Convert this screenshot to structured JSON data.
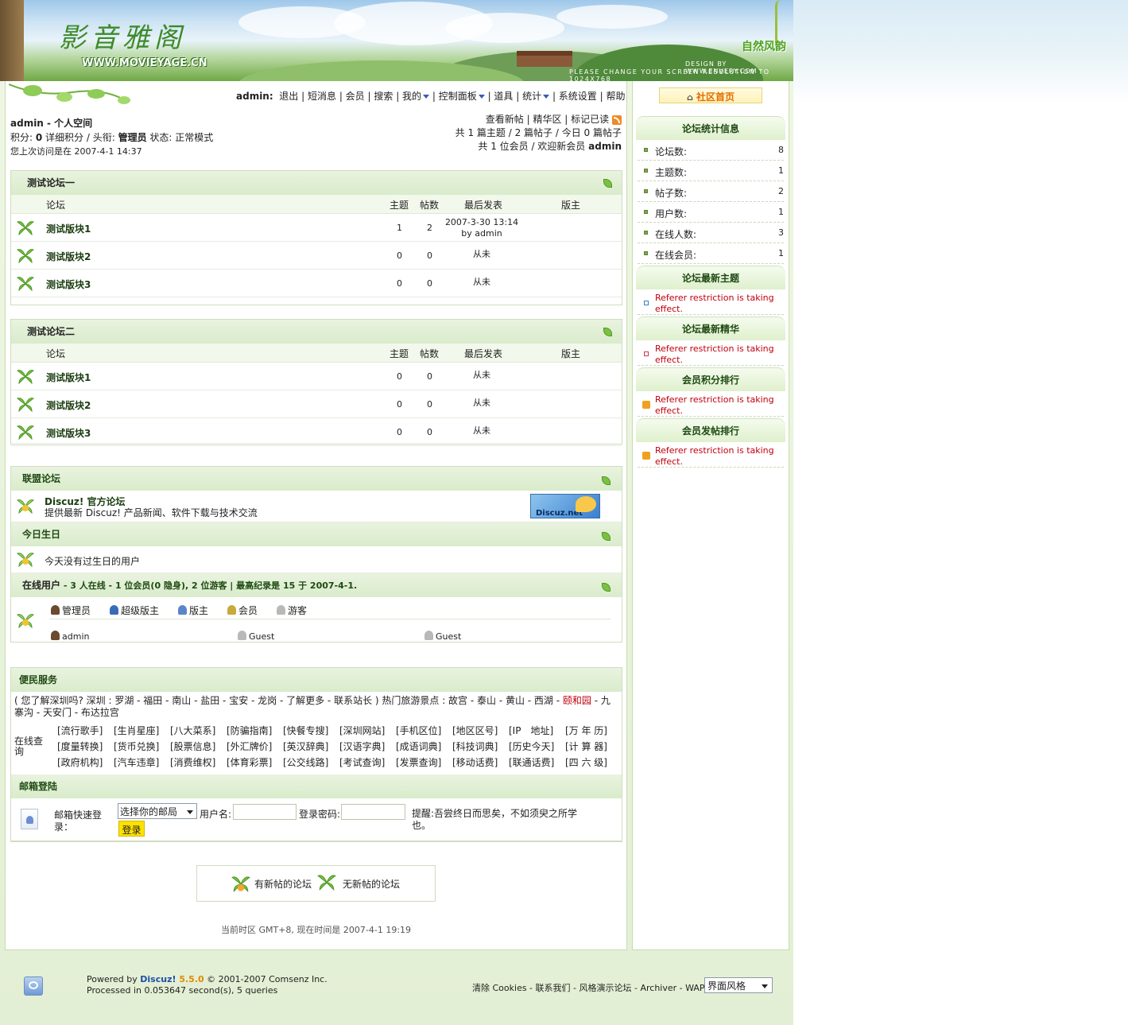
{
  "header": {
    "logo_title": "影音雅阁",
    "logo_url": "WWW.MOVIEYAGE.CN",
    "theme_name": "自然风韵",
    "design_by": "DESIGN BY WWW.ENVERY.COM",
    "resolution_note": "PLEASE CHANGE YOUR SCREEN RESOLUTION TO 1024X768"
  },
  "nav": {
    "user": "admin:",
    "items": [
      "退出",
      "短消息",
      "会员",
      "搜索",
      "我的",
      "控制面板",
      "道具",
      "统计",
      "系统设置",
      "帮助"
    ]
  },
  "user_info": {
    "space": "admin - 个人空间",
    "credits_line_1": "积分: ",
    "credits_value": "0",
    "credits_line_2": " 详细积分 / 头衔: ",
    "title_value": "管理员",
    "status": " 状态: 正常模式",
    "last_visit": "您上次访问是在 2007-4-1 14:37"
  },
  "posts_info": {
    "links": [
      "查看新帖",
      "精华区",
      "标记已读"
    ],
    "topics_line": "共 1 篇主题 / 2 篇帖子 / 今日 0 篇帖子",
    "members_line": "共 1 位会员 / 欢迎新会员 ",
    "newest_member": "admin"
  },
  "columns": {
    "forum": "论坛",
    "topics": "主题",
    "posts": "帖数",
    "last": "最后发表",
    "mod": "版主"
  },
  "categories": [
    {
      "name": "测试论坛一",
      "forums": [
        {
          "name": "测试版块1",
          "topics": "1",
          "posts": "2",
          "last": "2007-3-30 13:14",
          "by": "by admin"
        },
        {
          "name": "测试版块2",
          "topics": "0",
          "posts": "0",
          "last": "从未",
          "by": ""
        },
        {
          "name": "测试版块3",
          "topics": "0",
          "posts": "0",
          "last": "从未",
          "by": ""
        }
      ]
    },
    {
      "name": "测试论坛二",
      "forums": [
        {
          "name": "测试版块1",
          "topics": "0",
          "posts": "0",
          "last": "从未",
          "by": ""
        },
        {
          "name": "测试版块2",
          "topics": "0",
          "posts": "0",
          "last": "从未",
          "by": ""
        },
        {
          "name": "测试版块3",
          "topics": "0",
          "posts": "0",
          "last": "从未",
          "by": ""
        }
      ]
    }
  ],
  "links_box": {
    "title": "联盟论坛",
    "site_name": "Discuz! 官方论坛",
    "site_desc": "提供最新 Discuz! 产品新闻、软件下载与技术交流",
    "banner_text": "Discuz.net"
  },
  "birthday": {
    "title": "今日生日",
    "text": "今天没有过生日的用户"
  },
  "online": {
    "title": "在线用户",
    "summary": " - 3 人在线  - 1 位会员(0 隐身), 2 位游客  | 最高纪录是  15  于  2007-4-1.",
    "legend": [
      "管理员",
      "超级版主",
      "版主",
      "会员",
      "游客"
    ],
    "users": [
      "admin",
      "Guest",
      "Guest"
    ]
  },
  "services": {
    "title": "便民服务",
    "line": "( 您了解深圳吗? 深圳 : 罗湖 - 福田 - 南山 - 盐田 - 宝安 - 龙岗 - 了解更多 - 联系站长 ) 热门旅游景点 : 故宫 - 泰山 - 黄山 - 西湖 - ",
    "highlight": "颐和园",
    "line_end": " - 九寨沟 - 天安门 - 布达拉宫",
    "query_label": "在线查询",
    "query_rows": [
      [
        "[流行歌手]",
        "[生肖星座]",
        "[八大菜系]",
        "[防骗指南]",
        "[快餐专搜]",
        "[深圳网站]",
        "[手机区位]",
        "[地区区号]",
        "[IP　地址]",
        "[万 年 历]"
      ],
      [
        "[度量转换]",
        "[货币兑换]",
        "[股票信息]",
        "[外汇牌价]",
        "[英汉辞典]",
        "[汉语字典]",
        "[成语词典]",
        "[科技词典]",
        "[历史今天]",
        "[计 算 器]"
      ],
      [
        "[政府机构]",
        "[汽车违章]",
        "[消费维权]",
        "[体育彩票]",
        "[公交线路]",
        "[考试查询]",
        "[发票查询]",
        "[移动话费]",
        "[联通话费]",
        "[四 六 级]"
      ]
    ]
  },
  "mail": {
    "title": "邮箱登陆",
    "label": "邮箱快速登录：",
    "select": "选择你的邮局",
    "username_label": "用户名:",
    "password_label": "登录密码:",
    "login_button": "登录",
    "tip": "提醒:吾尝终日而思矣，不如须臾之所学也。"
  },
  "legend_box": {
    "new": "有新帖的论坛",
    "nonew": "无新帖的论坛"
  },
  "timezone": "当前时区 GMT+8, 现在时间是 2007-4-1 19:19",
  "sidebar": {
    "home": "社区首页",
    "stats_title": "论坛统计信息",
    "stats": [
      {
        "k": "论坛数:",
        "v": "8"
      },
      {
        "k": "主题数:",
        "v": "1"
      },
      {
        "k": "帖子数:",
        "v": "2"
      },
      {
        "k": "用户数:",
        "v": "1"
      },
      {
        "k": "在线人数:",
        "v": "3"
      },
      {
        "k": "在线会员:",
        "v": "1"
      }
    ],
    "blocks": [
      {
        "title": "论坛最新主题",
        "text": "Referer restriction is taking effect."
      },
      {
        "title": "论坛最新精华",
        "text": "Referer restriction is taking effect."
      },
      {
        "title": "会员积分排行",
        "text": "Referer restriction is taking effect."
      },
      {
        "title": "会员发帖排行",
        "text": "Referer restriction is taking effect."
      }
    ]
  },
  "footer": {
    "powered": "Powered by ",
    "brand": "Discuz!",
    "version": " 5.5.0",
    "copyright": " © 2001-2007 Comsenz Inc.",
    "processed": "Processed in 0.053647 second(s), 5 queries",
    "links": [
      "清除 Cookies",
      "联系我们",
      "风格演示论坛",
      "Archiver",
      "WAP"
    ],
    "style_select": "界面风格"
  },
  "colors": {
    "accent_green": "#1e4a12",
    "error_red": "#c0000c",
    "highlight_red": "#c0000c",
    "brand_blue": "#1f4fa8"
  }
}
